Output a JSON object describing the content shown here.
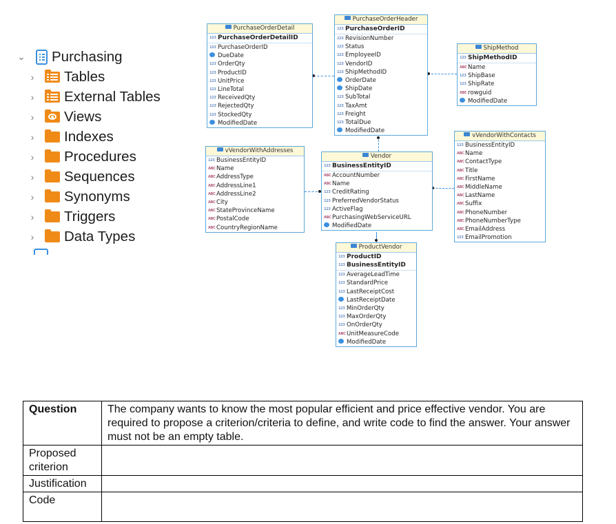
{
  "tree": {
    "schema": {
      "label": "Purchasing",
      "expanded": true,
      "icon": "schema-icon"
    },
    "items": [
      {
        "label": "Tables",
        "icon": "table-folder-icon"
      },
      {
        "label": "External Tables",
        "icon": "table-folder-icon"
      },
      {
        "label": "Views",
        "icon": "view-folder-icon"
      },
      {
        "label": "Indexes",
        "icon": "folder-icon"
      },
      {
        "label": "Procedures",
        "icon": "folder-icon"
      },
      {
        "label": "Sequences",
        "icon": "folder-icon"
      },
      {
        "label": "Synonyms",
        "icon": "folder-icon"
      },
      {
        "label": "Triggers",
        "icon": "folder-icon"
      },
      {
        "label": "Data Types",
        "icon": "folder-icon"
      }
    ]
  },
  "diagram": {
    "entities": {
      "purchase_order_detail": {
        "title": "PurchaseOrderDetail",
        "pk": [
          "PurchaseOrderDetailID"
        ],
        "columns": [
          {
            "name": "PurchaseOrderID",
            "type": "123"
          },
          {
            "name": "DueDate",
            "type": "date"
          },
          {
            "name": "OrderQty",
            "type": "123"
          },
          {
            "name": "ProductID",
            "type": "123"
          },
          {
            "name": "UnitPrice",
            "type": "123"
          },
          {
            "name": "LineTotal",
            "type": "123"
          },
          {
            "name": "ReceivedQty",
            "type": "123"
          },
          {
            "name": "RejectedQty",
            "type": "123"
          },
          {
            "name": "StockedQty",
            "type": "123"
          },
          {
            "name": "ModifiedDate",
            "type": "date"
          }
        ]
      },
      "purchase_order_header": {
        "title": "PurchaseOrderHeader",
        "pk": [
          "PurchaseOrderID"
        ],
        "columns": [
          {
            "name": "RevisionNumber",
            "type": "123"
          },
          {
            "name": "Status",
            "type": "123"
          },
          {
            "name": "EmployeeID",
            "type": "123"
          },
          {
            "name": "VendorID",
            "type": "123"
          },
          {
            "name": "ShipMethodID",
            "type": "123"
          },
          {
            "name": "OrderDate",
            "type": "date"
          },
          {
            "name": "ShipDate",
            "type": "date"
          },
          {
            "name": "SubTotal",
            "type": "123"
          },
          {
            "name": "TaxAmt",
            "type": "123"
          },
          {
            "name": "Freight",
            "type": "123"
          },
          {
            "name": "TotalDue",
            "type": "123"
          },
          {
            "name": "ModifiedDate",
            "type": "date"
          }
        ]
      },
      "ship_method": {
        "title": "ShipMethod",
        "pk": [
          "ShipMethodID"
        ],
        "columns": [
          {
            "name": "Name",
            "type": "abc"
          },
          {
            "name": "ShipBase",
            "type": "123"
          },
          {
            "name": "ShipRate",
            "type": "123"
          },
          {
            "name": "rowguid",
            "type": "abc"
          },
          {
            "name": "ModifiedDate",
            "type": "date"
          }
        ]
      },
      "v_vendor_with_addresses": {
        "title": "vVendorWithAddresses",
        "pk": [],
        "columns": [
          {
            "name": "BusinessEntityID",
            "type": "123"
          },
          {
            "name": "Name",
            "type": "abc"
          },
          {
            "name": "AddressType",
            "type": "abc"
          },
          {
            "name": "AddressLine1",
            "type": "abc"
          },
          {
            "name": "AddressLine2",
            "type": "abc"
          },
          {
            "name": "City",
            "type": "abc"
          },
          {
            "name": "StateProvinceName",
            "type": "abc"
          },
          {
            "name": "PostalCode",
            "type": "abc"
          },
          {
            "name": "CountryRegionName",
            "type": "abc"
          }
        ]
      },
      "vendor": {
        "title": "Vendor",
        "pk": [
          "BusinessEntityID"
        ],
        "columns": [
          {
            "name": "AccountNumber",
            "type": "abc"
          },
          {
            "name": "Name",
            "type": "abc"
          },
          {
            "name": "CreditRating",
            "type": "123"
          },
          {
            "name": "PreferredVendorStatus",
            "type": "123"
          },
          {
            "name": "ActiveFlag",
            "type": "123"
          },
          {
            "name": "PurchasingWebServiceURL",
            "type": "abc"
          },
          {
            "name": "ModifiedDate",
            "type": "date"
          }
        ]
      },
      "v_vendor_with_contacts": {
        "title": "vVendorWithContacts",
        "pk": [],
        "columns": [
          {
            "name": "BusinessEntityID",
            "type": "123"
          },
          {
            "name": "Name",
            "type": "abc"
          },
          {
            "name": "ContactType",
            "type": "abc"
          },
          {
            "name": "Title",
            "type": "abc"
          },
          {
            "name": "FirstName",
            "type": "abc"
          },
          {
            "name": "MiddleName",
            "type": "abc"
          },
          {
            "name": "LastName",
            "type": "abc"
          },
          {
            "name": "Suffix",
            "type": "abc"
          },
          {
            "name": "PhoneNumber",
            "type": "abc"
          },
          {
            "name": "PhoneNumberType",
            "type": "abc"
          },
          {
            "name": "EmailAddress",
            "type": "abc"
          },
          {
            "name": "EmailPromotion",
            "type": "123"
          }
        ]
      },
      "product_vendor": {
        "title": "ProductVendor",
        "pk": [
          "ProductID",
          "BusinessEntityID"
        ],
        "columns": [
          {
            "name": "AverageLeadTime",
            "type": "123"
          },
          {
            "name": "StandardPrice",
            "type": "123"
          },
          {
            "name": "LastReceiptCost",
            "type": "123"
          },
          {
            "name": "LastReceiptDate",
            "type": "date"
          },
          {
            "name": "MinOrderQty",
            "type": "123"
          },
          {
            "name": "MaxOrderQty",
            "type": "123"
          },
          {
            "name": "OnOrderQty",
            "type": "123"
          },
          {
            "name": "UnitMeasureCode",
            "type": "abc"
          },
          {
            "name": "ModifiedDate",
            "type": "date"
          }
        ]
      }
    },
    "type_glyphs": {
      "123": "123",
      "abc": "ABC"
    }
  },
  "question_table": {
    "rows": [
      {
        "label": "Question",
        "content": "The company wants to know the most popular efficient and price effective vendor. You are required to propose a criterion/criteria to define, and write code to find the answer. Your answer must not be an empty table."
      },
      {
        "label": "Proposed criterion",
        "content": ""
      },
      {
        "label": "Justification",
        "content": ""
      },
      {
        "label": "Code",
        "content": ""
      }
    ]
  },
  "colors": {
    "accent_blue": "#3b8fe0",
    "folder_orange": "#f08a17",
    "entity_header": "#fdf8d8"
  }
}
